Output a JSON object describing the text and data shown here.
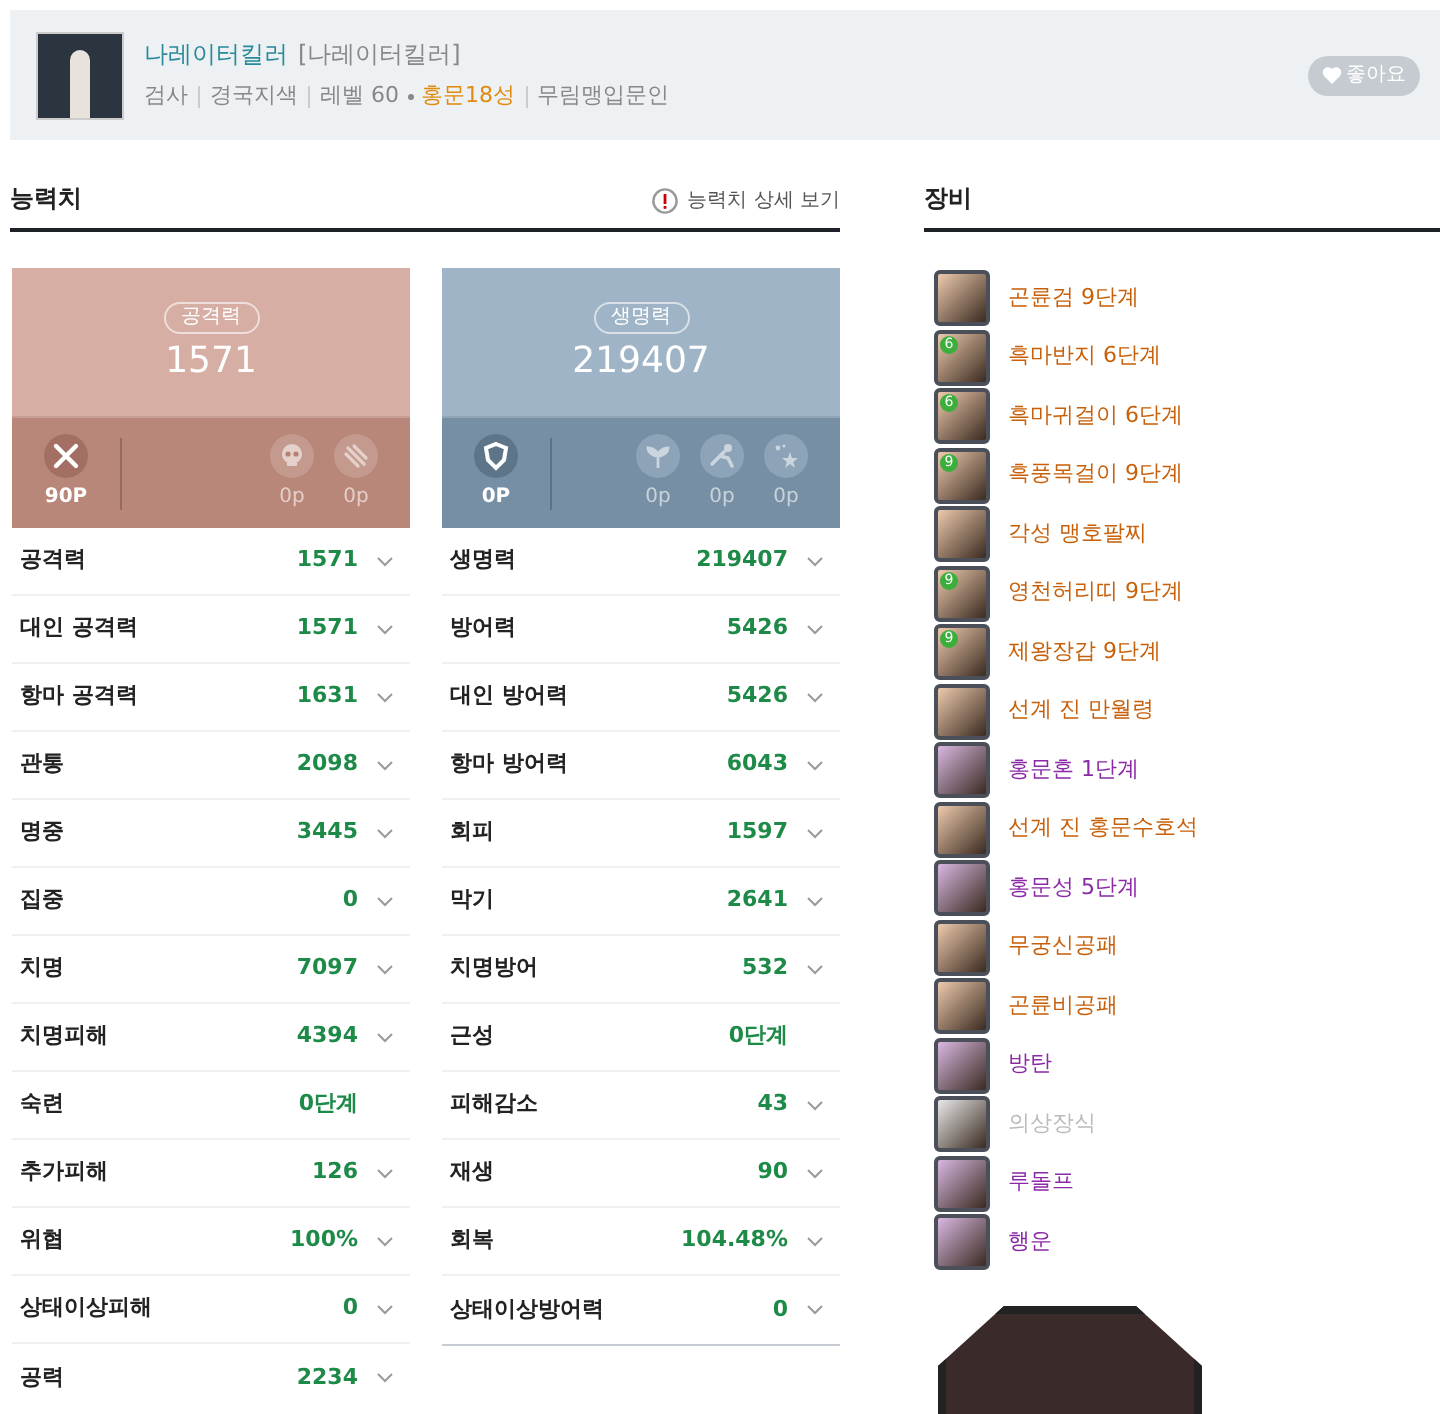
{
  "profile": {
    "name": "나레이터킬러",
    "alias": "[나레이터킬러]",
    "details": [
      {
        "text": "검사",
        "kind": "plain"
      },
      {
        "text": "경국지색",
        "kind": "plain"
      },
      {
        "text": "레벨 60",
        "kind": "plain"
      },
      {
        "text": "홍문18성",
        "kind": "highlight"
      },
      {
        "text": "무림맹입문인",
        "kind": "plain"
      }
    ],
    "like_button": "좋아요"
  },
  "stats_section": {
    "title": "능력치",
    "detail_link": "능력치 상세 보기",
    "cards": [
      {
        "kind": "attack",
        "label": "공격력",
        "value": "1571",
        "points": [
          {
            "text": "90P",
            "active": true
          },
          {
            "text": "0p",
            "active": false
          },
          {
            "text": "0p",
            "active": false
          }
        ]
      },
      {
        "kind": "defense",
        "label": "생명력",
        "value": "219407",
        "points": [
          {
            "text": "0P",
            "active": true
          },
          {
            "text": "0p",
            "active": false
          },
          {
            "text": "0p",
            "active": false
          },
          {
            "text": "0p",
            "active": false
          }
        ]
      }
    ],
    "columns": [
      [
        {
          "label": "공격력",
          "value": "1571",
          "expandable": true
        },
        {
          "label": "대인 공격력",
          "value": "1571",
          "expandable": true
        },
        {
          "label": "항마 공격력",
          "value": "1631",
          "expandable": true
        },
        {
          "label": "관통",
          "value": "2098",
          "expandable": true
        },
        {
          "label": "명중",
          "value": "3445",
          "expandable": true
        },
        {
          "label": "집중",
          "value": "0",
          "expandable": true
        },
        {
          "label": "치명",
          "value": "7097",
          "expandable": true
        },
        {
          "label": "치명피해",
          "value": "4394",
          "expandable": true
        },
        {
          "label": "숙련",
          "value": "0단계",
          "expandable": false
        },
        {
          "label": "추가피해",
          "value": "126",
          "expandable": true
        },
        {
          "label": "위협",
          "value": "100%",
          "expandable": true
        },
        {
          "label": "상태이상피해",
          "value": "0",
          "expandable": true
        },
        {
          "label": "공력",
          "value": "2234",
          "expandable": true
        }
      ],
      [
        {
          "label": "생명력",
          "value": "219407",
          "expandable": true
        },
        {
          "label": "방어력",
          "value": "5426",
          "expandable": true
        },
        {
          "label": "대인 방어력",
          "value": "5426",
          "expandable": true
        },
        {
          "label": "항마 방어력",
          "value": "6043",
          "expandable": true
        },
        {
          "label": "회피",
          "value": "1597",
          "expandable": true
        },
        {
          "label": "막기",
          "value": "2641",
          "expandable": true
        },
        {
          "label": "치명방어",
          "value": "532",
          "expandable": true
        },
        {
          "label": "근성",
          "value": "0단계",
          "expandable": false
        },
        {
          "label": "피해감소",
          "value": "43",
          "expandable": true
        },
        {
          "label": "재생",
          "value": "90",
          "expandable": true
        },
        {
          "label": "회복",
          "value": "104.48%",
          "expandable": true
        },
        {
          "label": "상태이상방어력",
          "value": "0",
          "expandable": true
        }
      ]
    ]
  },
  "equipment": {
    "title": "장비",
    "items": [
      {
        "name": "곤륜검 9단계",
        "color": "#c8600a"
      },
      {
        "name": "흑마반지 6단계",
        "color": "#c8600a",
        "badge": "6"
      },
      {
        "name": "흑마귀걸이 6단계",
        "color": "#c8600a",
        "badge": "6"
      },
      {
        "name": "흑풍목걸이 9단계",
        "color": "#c8600a",
        "badge": "9"
      },
      {
        "name": "각성 맹호팔찌",
        "color": "#c8600a"
      },
      {
        "name": "영천허리띠 9단계",
        "color": "#c8600a",
        "badge": "9"
      },
      {
        "name": "제왕장갑 9단계",
        "color": "#c8600a",
        "badge": "9"
      },
      {
        "name": "선계 진 만월령",
        "color": "#c8600a"
      },
      {
        "name": "홍문혼 1단계",
        "color": "#8b2aa6"
      },
      {
        "name": "선계 진 홍문수호석",
        "color": "#c8600a"
      },
      {
        "name": "홍문성 5단계",
        "color": "#8b2aa6"
      },
      {
        "name": "무궁신공패",
        "color": "#c8600a"
      },
      {
        "name": "곤륜비공패",
        "color": "#c8600a"
      },
      {
        "name": "방탄",
        "color": "#8b2aa6"
      },
      {
        "name": "의상장식",
        "color": "#bbbbbb"
      },
      {
        "name": "루돌프",
        "color": "#8b2aa6"
      },
      {
        "name": "행운",
        "color": "#8b2aa6"
      }
    ]
  }
}
